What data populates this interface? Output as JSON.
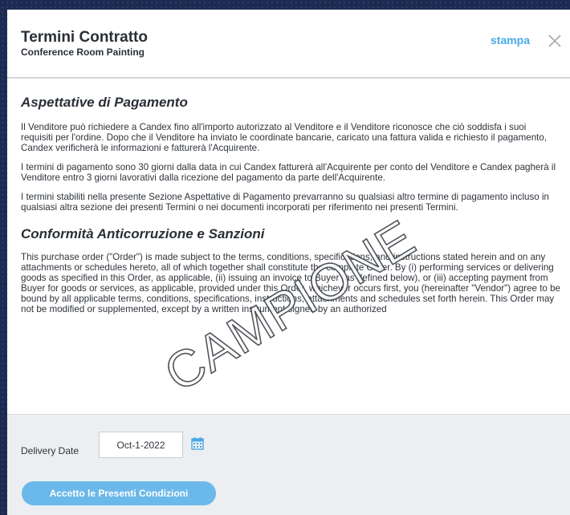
{
  "header": {
    "title": "Termini Contratto",
    "subtitle": "Conference Room Painting",
    "print_label": "stampa"
  },
  "watermark": "CAMPIONE",
  "sections": [
    {
      "title": "Aspettative di Pagamento",
      "paragraphs": [
        "Il Venditore può richiedere a Candex fino all'importo autorizzato al Venditore e il Venditore riconosce che ciò soddisfa i suoi requisiti per l'ordine. Dopo che il Venditore ha inviato le coordinate bancarie, caricato una fattura valida e richiesto il pagamento, Candex verificherà le informazioni e fatturerà l'Acquirente.",
        "I termini di pagamento sono 30 giorni dalla data in cui Candex fatturerà all'Acquirente per conto del Venditore e Candex pagherà il Venditore entro 3 giorni lavorativi dalla ricezione del pagamento da parte dell'Acquirente.",
        "I termini stabiliti nella presente Sezione Aspettative di Pagamento prevarranno su qualsiasi altro termine di pagamento incluso in qualsiasi altra sezione dei presenti Termini o nei documenti incorporati per riferimento nei presenti Termini."
      ]
    },
    {
      "title": "Conformità Anticorruzione e Sanzioni",
      "paragraphs": [
        "This purchase order (\"Order\") is made subject to the terms, conditions, specifications, and instructions stated herein and on any attachments or schedules hereto, all of which together shall constitute the complete Order. By (i) performing services or delivering goods as specified in this Order, as applicable, (ii) issuing an invoice to Buyer (as defined below), or (iii) accepting payment from Buyer for goods or services, as applicable, provided under this Order, whichever occurs first, you (hereinafter \"Vendor\") agree to be bound by all applicable terms, conditions, specifications, instructions, attachments and schedules set forth herein. This Order may not be modified or supplemented, except by a written instrument signed by an authorized"
      ]
    }
  ],
  "footer": {
    "delivery_label": "Delivery Date",
    "delivery_value": "Oct-1-2022",
    "accept_label": "Accetto le Presenti Condizioni"
  },
  "colors": {
    "accent": "#49a9e4",
    "button": "#6bb8ea",
    "backdrop": "#1c2b52"
  },
  "icons": [
    "close-icon",
    "calendar-icon"
  ]
}
